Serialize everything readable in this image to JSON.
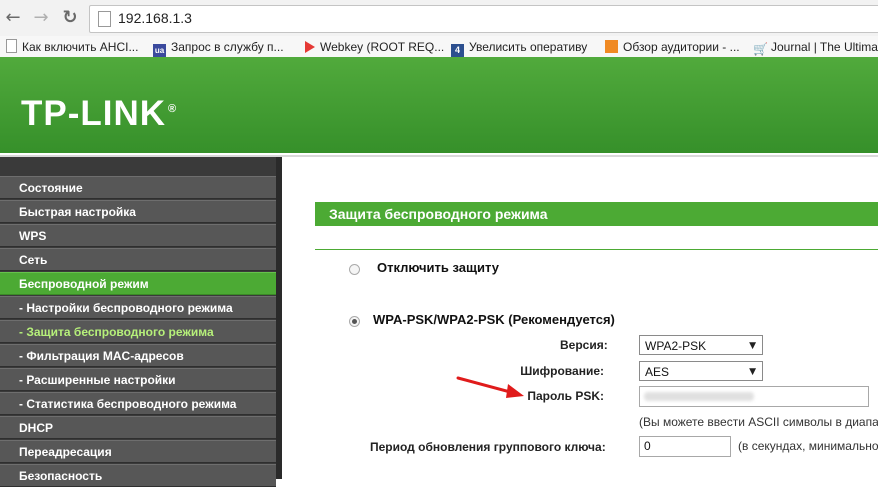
{
  "browser": {
    "url": "192.168.1.3",
    "back_icon": "arrow-left-icon",
    "forward_icon": "arrow-right-icon",
    "reload_icon": "reload-icon"
  },
  "bookmarks": [
    {
      "label": "Как включить AHCI..."
    },
    {
      "label": "Запрос в службу п..."
    },
    {
      "label": "Webkey (ROOT REQ..."
    },
    {
      "label": "Увелисить оперативу"
    },
    {
      "label": "Обзор аудитории - ..."
    },
    {
      "label": "Journal | The Ultima"
    }
  ],
  "header": {
    "logo": "TP-LINK",
    "logo_mark": "®",
    "brand_color": "#3f9a2e"
  },
  "sidebar": {
    "items": [
      {
        "label": "Состояние"
      },
      {
        "label": "Быстрая настройка"
      },
      {
        "label": "WPS"
      },
      {
        "label": "Сеть"
      },
      {
        "label": "Беспроводной режим"
      },
      {
        "label": "- Настройки беспроводного режима"
      },
      {
        "label": "- Защита беспроводного режима"
      },
      {
        "label": "- Фильтрация MAC-адресов"
      },
      {
        "label": "- Расширенные настройки"
      },
      {
        "label": "- Статистика беспроводного режима"
      },
      {
        "label": "DHCP"
      },
      {
        "label": "Переадресация"
      },
      {
        "label": "Безопасность"
      }
    ]
  },
  "main": {
    "title": "Защита беспроводного режима",
    "option_disable": "Отключить защиту",
    "option_wpa": "WPA-PSK/WPA2-PSK (Рекомендуется)",
    "version_label": "Версия:",
    "version_value": "WPA2-PSK",
    "encryption_label": "Шифрование:",
    "encryption_value": "AES",
    "psk_label": "Пароль PSK:",
    "psk_hint": "(Вы можете ввести ASCII символы в диапа",
    "group_key_label": "Период обновления группового ключа:",
    "group_key_value": "0",
    "group_key_hint": "(в секундах, минимально"
  }
}
